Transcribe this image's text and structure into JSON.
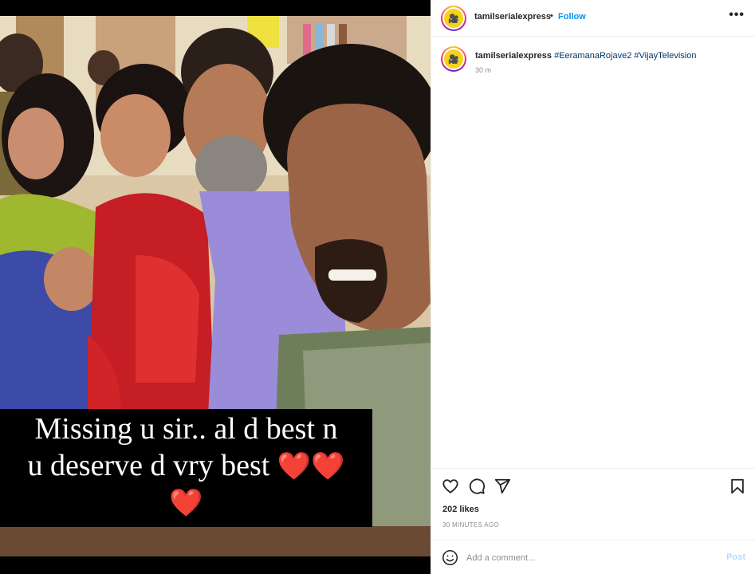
{
  "post": {
    "username": "tamilserialexpress",
    "separator": "•",
    "follow_label": "Follow",
    "more_icon": "more-horizontal-icon",
    "caption": {
      "hashtags": [
        "#EeramanaRojave2",
        "#VijayTelevision"
      ],
      "time": "30 m"
    },
    "image_caption_lines": [
      "Missing u sir.. al d best n",
      "u deserve d vry best"
    ],
    "image_caption_emoji": [
      "❤️",
      "❤️",
      "❤️"
    ],
    "likes": "202 likes",
    "time_ago": "30 MINUTES AGO"
  },
  "actions": {
    "icons": [
      "heart-icon",
      "comment-bubble-icon",
      "send-icon",
      "bookmark-icon"
    ]
  },
  "comment_box": {
    "placeholder": "Add a comment...",
    "post_label": "Post",
    "emoji_icon": "smiley-icon"
  },
  "colors": {
    "follow": "#0095f6",
    "hashtag": "#00376b",
    "post_disabled": "#b3dbff",
    "muted": "#8e8e8e"
  }
}
